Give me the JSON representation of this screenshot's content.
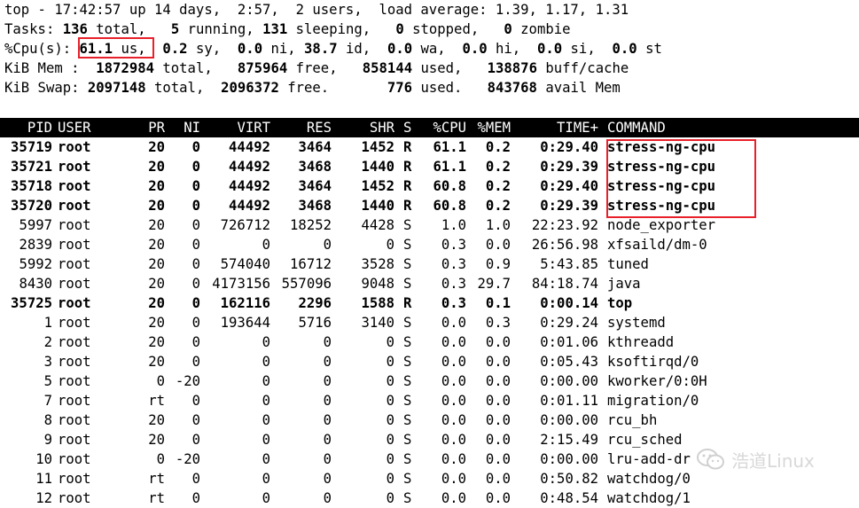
{
  "summary": {
    "uptime_line": "top - 17:42:57 up 14 days,  2:57,  2 users,  load average: 1.39, 1.17, 1.31",
    "tasks": {
      "label": "Tasks:",
      "total": "136",
      "total_label": "total,",
      "running": "5",
      "running_label": "running,",
      "sleeping": "131",
      "sleeping_label": "sleeping,",
      "stopped": "0",
      "stopped_label": "stopped,",
      "zombie": "0",
      "zombie_label": "zombie"
    },
    "cpu": {
      "label": "%Cpu(s):",
      "us": "61.1",
      "us_label": "us,",
      "sy": "0.2",
      "sy_label": "sy,",
      "ni": "0.0",
      "ni_label": "ni,",
      "id": "38.7",
      "id_label": "id,",
      "wa": "0.0",
      "wa_label": "wa,",
      "hi": "0.0",
      "hi_label": "hi,",
      "si": "0.0",
      "si_label": "si,",
      "st": "0.0",
      "st_label": "st"
    },
    "mem": {
      "label": "KiB Mem :",
      "total": "1872984",
      "total_label": "total,",
      "free": "875964",
      "free_label": "free,",
      "used": "858144",
      "used_label": "used,",
      "buff": "138876",
      "buff_label": "buff/cache"
    },
    "swap": {
      "label": "KiB Swap:",
      "total": "2097148",
      "total_label": "total,",
      "free": "2096372",
      "free_label": "free.",
      "used": "776",
      "used_label": "used.",
      "avail": "843768",
      "avail_label": "avail Mem"
    }
  },
  "table": {
    "headers": [
      "PID",
      "USER",
      "PR",
      "NI",
      "VIRT",
      "RES",
      "SHR",
      "S",
      "%CPU",
      "%MEM",
      "TIME+",
      "COMMAND"
    ],
    "rows": [
      {
        "bold": true,
        "cells": [
          "35719",
          "root",
          "20",
          "0",
          "44492",
          "3464",
          "1452",
          "R",
          "61.1",
          "0.2",
          "0:29.40",
          "stress-ng-cpu"
        ]
      },
      {
        "bold": true,
        "cells": [
          "35721",
          "root",
          "20",
          "0",
          "44492",
          "3468",
          "1440",
          "R",
          "61.1",
          "0.2",
          "0:29.39",
          "stress-ng-cpu"
        ]
      },
      {
        "bold": true,
        "cells": [
          "35718",
          "root",
          "20",
          "0",
          "44492",
          "3464",
          "1452",
          "R",
          "60.8",
          "0.2",
          "0:29.40",
          "stress-ng-cpu"
        ]
      },
      {
        "bold": true,
        "cells": [
          "35720",
          "root",
          "20",
          "0",
          "44492",
          "3468",
          "1440",
          "R",
          "60.8",
          "0.2",
          "0:29.39",
          "stress-ng-cpu"
        ]
      },
      {
        "bold": false,
        "cells": [
          "5997",
          "root",
          "20",
          "0",
          "726712",
          "18252",
          "4428",
          "S",
          "1.0",
          "1.0",
          "22:23.92",
          "node_exporter"
        ]
      },
      {
        "bold": false,
        "cells": [
          "2839",
          "root",
          "20",
          "0",
          "0",
          "0",
          "0",
          "S",
          "0.3",
          "0.0",
          "26:56.98",
          "xfsaild/dm-0"
        ]
      },
      {
        "bold": false,
        "cells": [
          "5992",
          "root",
          "20",
          "0",
          "574040",
          "16712",
          "3528",
          "S",
          "0.3",
          "0.9",
          "5:43.85",
          "tuned"
        ]
      },
      {
        "bold": false,
        "cells": [
          "8430",
          "root",
          "20",
          "0",
          "4173156",
          "557096",
          "9048",
          "S",
          "0.3",
          "29.7",
          "84:18.74",
          "java"
        ]
      },
      {
        "bold": true,
        "cells": [
          "35725",
          "root",
          "20",
          "0",
          "162116",
          "2296",
          "1588",
          "R",
          "0.3",
          "0.1",
          "0:00.14",
          "top"
        ]
      },
      {
        "bold": false,
        "cells": [
          "1",
          "root",
          "20",
          "0",
          "193644",
          "5716",
          "3140",
          "S",
          "0.0",
          "0.3",
          "0:29.24",
          "systemd"
        ]
      },
      {
        "bold": false,
        "cells": [
          "2",
          "root",
          "20",
          "0",
          "0",
          "0",
          "0",
          "S",
          "0.0",
          "0.0",
          "0:01.06",
          "kthreadd"
        ]
      },
      {
        "bold": false,
        "cells": [
          "3",
          "root",
          "20",
          "0",
          "0",
          "0",
          "0",
          "S",
          "0.0",
          "0.0",
          "0:05.43",
          "ksoftirqd/0"
        ]
      },
      {
        "bold": false,
        "cells": [
          "5",
          "root",
          "0",
          "-20",
          "0",
          "0",
          "0",
          "S",
          "0.0",
          "0.0",
          "0:00.00",
          "kworker/0:0H"
        ]
      },
      {
        "bold": false,
        "cells": [
          "7",
          "root",
          "rt",
          "0",
          "0",
          "0",
          "0",
          "S",
          "0.0",
          "0.0",
          "0:01.11",
          "migration/0"
        ]
      },
      {
        "bold": false,
        "cells": [
          "8",
          "root",
          "20",
          "0",
          "0",
          "0",
          "0",
          "S",
          "0.0",
          "0.0",
          "0:00.00",
          "rcu_bh"
        ]
      },
      {
        "bold": false,
        "cells": [
          "9",
          "root",
          "20",
          "0",
          "0",
          "0",
          "0",
          "S",
          "0.0",
          "0.0",
          "2:15.49",
          "rcu_sched"
        ]
      },
      {
        "bold": false,
        "cells": [
          "10",
          "root",
          "0",
          "-20",
          "0",
          "0",
          "0",
          "S",
          "0.0",
          "0.0",
          "0:00.00",
          "lru-add-dr"
        ]
      },
      {
        "bold": false,
        "cells": [
          "11",
          "root",
          "rt",
          "0",
          "0",
          "0",
          "0",
          "S",
          "0.0",
          "0.0",
          "0:50.82",
          "watchdog/0"
        ]
      },
      {
        "bold": false,
        "cells": [
          "12",
          "root",
          "rt",
          "0",
          "0",
          "0",
          "0",
          "S",
          "0.0",
          "0.0",
          "0:48.54",
          "watchdog/1"
        ]
      }
    ]
  },
  "highlight_color": "#e8202a",
  "watermark": {
    "text": "浩道Linux",
    "icon": "wechat-logo-icon"
  }
}
